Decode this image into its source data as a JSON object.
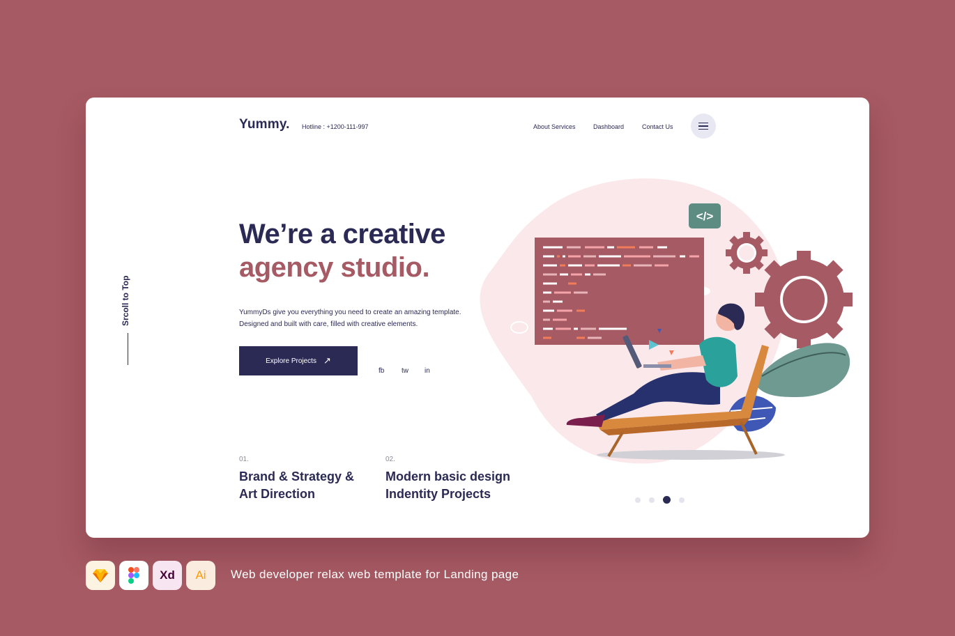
{
  "header": {
    "logo": "Yummy.",
    "hotline": "Hotline : +1200-111-997",
    "nav": [
      "About Services",
      "Dashboard",
      "Contact Us"
    ]
  },
  "sidebar": {
    "scroll_label": "Srcoll to Top"
  },
  "hero": {
    "title_line1": "We’re a creative",
    "title_line2": "agency studio.",
    "description": "YummyDs give you everything you need to create an amazing template.  Designed and built with care, filled with creative elements.",
    "cta_label": "Explore Projects",
    "cta_icon": "arrow-up-right-icon"
  },
  "social": [
    "fb",
    "tw",
    "in"
  ],
  "features": [
    {
      "num": "01.",
      "title": "Brand & Strategy & Art Direction"
    },
    {
      "num": "02.",
      "title": "Modern basic design Indentity Projects"
    }
  ],
  "illustration": {
    "code_badge": "</>"
  },
  "carousel": {
    "count": 4,
    "active": 3
  },
  "tools": [
    "sketch-icon",
    "figma-icon",
    "Xd",
    "Ai"
  ],
  "caption": "Web developer relax web template for Landing page",
  "colors": {
    "background": "#a65a63",
    "navy": "#2b2a55",
    "accent": "#a65a63"
  }
}
